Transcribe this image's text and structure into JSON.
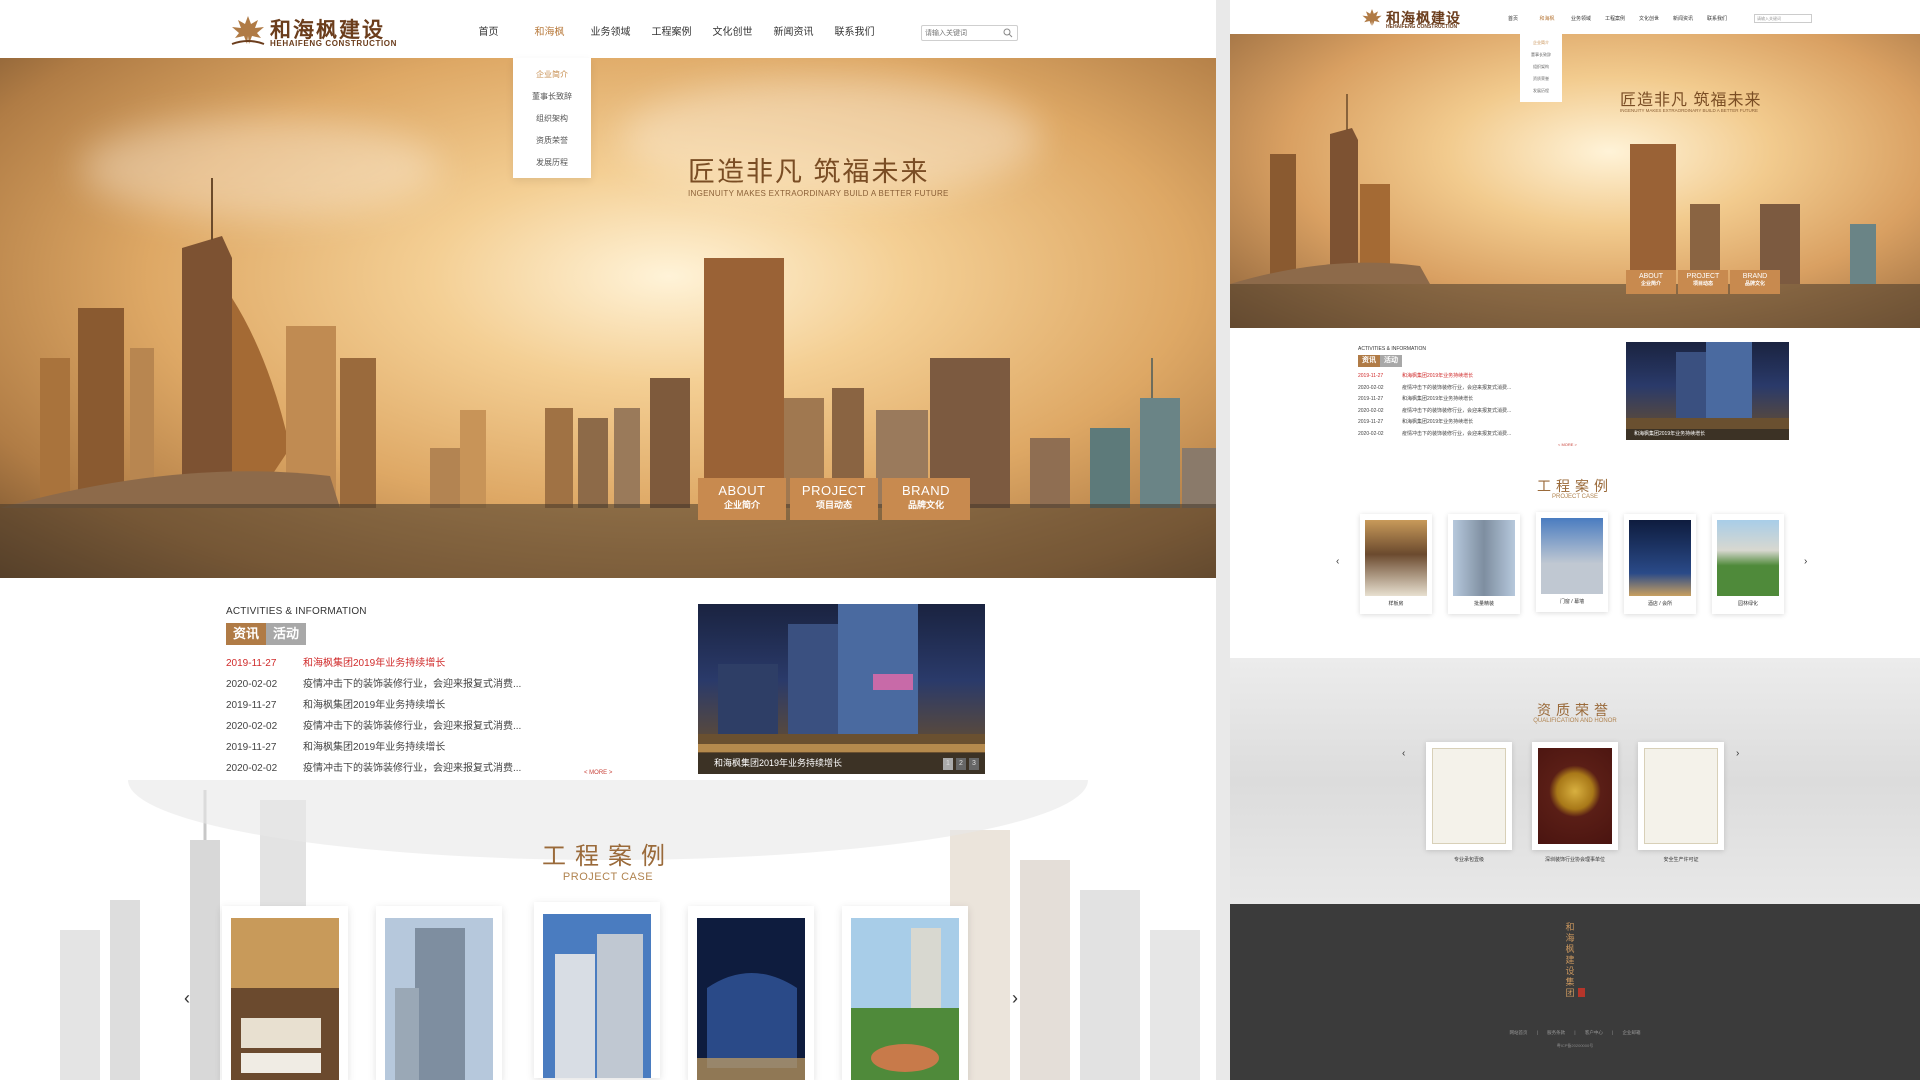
{
  "site": {
    "logo_cn": "和海枫建设",
    "logo_en": "HEHAIFENG CONSTRUCTION"
  },
  "nav": {
    "items": [
      "首页",
      "和海枫",
      "业务领域",
      "工程案例",
      "文化创世",
      "新闻资讯",
      "联系我们"
    ],
    "active_index": 1,
    "search_placeholder": "请输入关键词"
  },
  "dropdown": {
    "items": [
      "企业简介",
      "董事长致辞",
      "组织架构",
      "资质荣誉",
      "发展历程"
    ],
    "active_index": 0
  },
  "hero": {
    "title": "匠造非凡 筑福未来",
    "subtitle": "INGENUITY MAKES EXTRAORDINARY BUILD A BETTER FUTURE",
    "tabs": [
      {
        "en": "ABOUT",
        "cn": "企业简介"
      },
      {
        "en": "PROJECT",
        "cn": "项目动态"
      },
      {
        "en": "BRAND",
        "cn": "品牌文化"
      }
    ]
  },
  "news": {
    "heading": "ACTIVITIES & INFORMATION",
    "tab_on": "资讯",
    "tab_off": "活动",
    "rows": [
      {
        "date": "2019-11-27",
        "title": "和海枫集团2019年业务持续增长",
        "hot": true
      },
      {
        "date": "2020-02-02",
        "title": "疫情冲击下的装饰装修行业，会迎来报复式消费...",
        "hot": false
      },
      {
        "date": "2019-11-27",
        "title": "和海枫集团2019年业务持续增长",
        "hot": false
      },
      {
        "date": "2020-02-02",
        "title": "疫情冲击下的装饰装修行业，会迎来报复式消费...",
        "hot": false
      },
      {
        "date": "2019-11-27",
        "title": "和海枫集团2019年业务持续增长",
        "hot": false
      },
      {
        "date": "2020-02-02",
        "title": "疫情冲击下的装饰装修行业，会迎来报复式消费...",
        "hot": false
      }
    ],
    "more": "< MORE >",
    "photo_caption": "和海枫集团2019年业务持续增长",
    "photo_dots": [
      "1",
      "2",
      "3"
    ]
  },
  "cases": {
    "title": "工程案例",
    "subtitle": "PROJECT CASE",
    "prev": "‹",
    "next": "›",
    "items": [
      {
        "caption": "样板房"
      },
      {
        "caption": "批量精装"
      },
      {
        "caption": "门窗 / 幕墙"
      },
      {
        "caption": "酒店 / 会所"
      },
      {
        "caption": "园林绿化"
      }
    ]
  },
  "honor": {
    "title": "资质荣誉",
    "subtitle": "QUALIFICATION AND HONOR",
    "items": [
      {
        "caption": "专业承包壹级"
      },
      {
        "caption": "深圳装饰行业协会理事单位"
      },
      {
        "caption": "安全生产许可证"
      }
    ]
  },
  "footer": {
    "brand_vertical": "和海枫建设集团",
    "links": "网站首页 | 服务条款 | 客户中心 | 企业邮箱",
    "copyright": "粤ICP备20200000号"
  }
}
